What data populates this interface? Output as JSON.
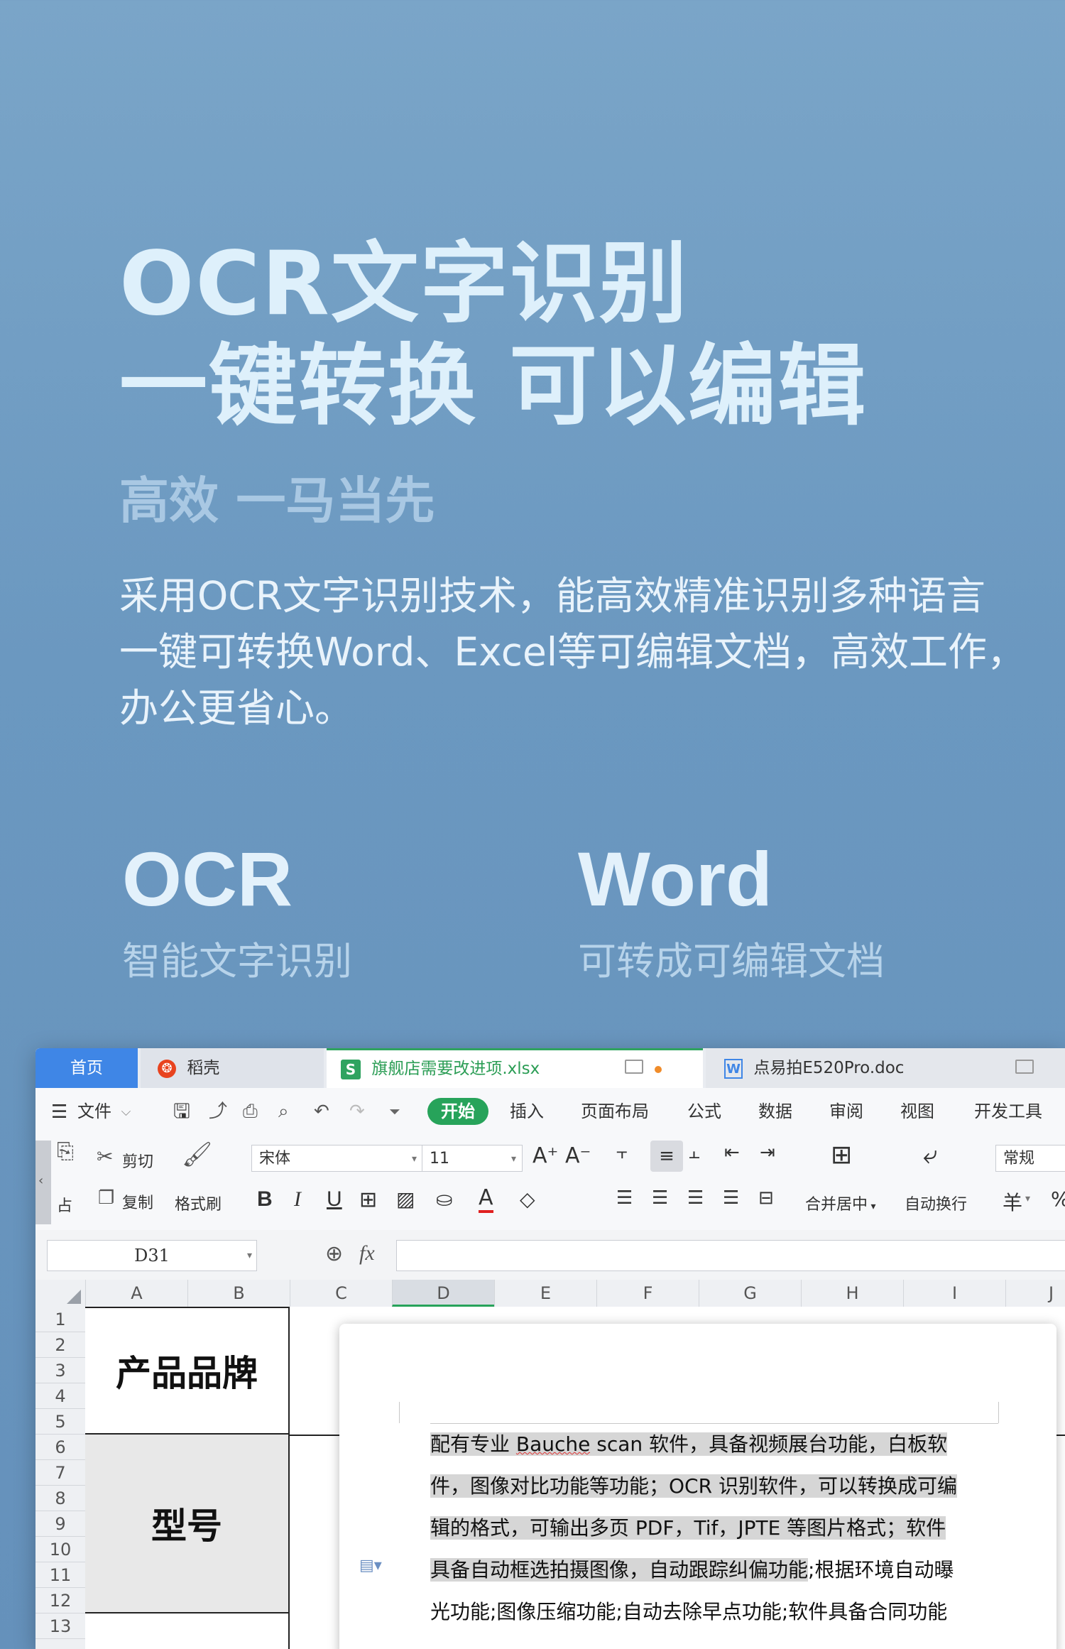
{
  "hero": {
    "title_line1": "OCR文字识别",
    "title_line2": "一键转换 可以编辑",
    "subtitle": "高效 一马当先",
    "desc_line1": "采用OCR文字识别技术，能高效精准识别多种语言",
    "desc_line2": "一键可转换Word、Excel等可编辑文档，高效工作，",
    "desc_line3": "办公更省心。",
    "feature1_title": "OCR",
    "feature1_sub": "智能文字识别",
    "feature2_title": "Word",
    "feature2_sub": "可转成可编辑文档",
    "text_color": "#def0fb"
  },
  "app": {
    "tabs": {
      "home": "首页",
      "daoke": "稻壳",
      "xlsx": "旗舰店需要改进项.xlsx",
      "doc": "点易拍E520Pro.doc"
    },
    "menu": {
      "file": "文件",
      "start": "开始",
      "insert": "插入",
      "layout": "页面布局",
      "formula": "公式",
      "data": "数据",
      "review": "审阅",
      "view": "视图",
      "dev": "开发工具"
    },
    "ribbon": {
      "cut": "剪切",
      "copy": "复制",
      "paste_partial": "占",
      "format_painter": "格式刷",
      "font_name": "宋体",
      "font_size": "11",
      "merge_center": "合并居中",
      "wrap_text": "自动换行",
      "number_format": "常规",
      "currency": "羊",
      "percent": "%"
    },
    "formula_bar": {
      "name_box": "D31",
      "fx": "fx"
    },
    "columns": [
      "A",
      "B",
      "C",
      "D",
      "E",
      "F",
      "G",
      "H",
      "I",
      "J"
    ],
    "rows": [
      "1",
      "2",
      "3",
      "4",
      "5",
      "6",
      "7",
      "8",
      "9",
      "10",
      "11",
      "12",
      "13"
    ],
    "cells": {
      "brand": "产品品牌",
      "model": "型号"
    },
    "doc_lines": [
      {
        "before": "",
        "highlight": "配有专业 ",
        "squig": "Bauche",
        "after": " scan 软件，具备视频展台功能，白板软"
      },
      {
        "before": "",
        "highlight": "件，图像对比功能等功能；OCR 识别软件，可以转换成可编",
        "squig": "",
        "after": ""
      },
      {
        "before": "",
        "highlight": "辑的格式，可输出多页 PDF，Tif，JPTE 等图片格式；软件",
        "squig": "",
        "after": ""
      },
      {
        "before": "",
        "highlight": "具备自动框选拍摄图像，自动跟踪纠偏功能",
        "squig": "",
        "after": ";根据环境自动曝"
      },
      {
        "before": "光功能;图像压缩功能;自动去除早点功能;软件具备合同功能",
        "highlight": "",
        "squig": "",
        "after": ""
      }
    ],
    "accent_green": "#27a35a",
    "accent_blue": "#3f86e6"
  }
}
